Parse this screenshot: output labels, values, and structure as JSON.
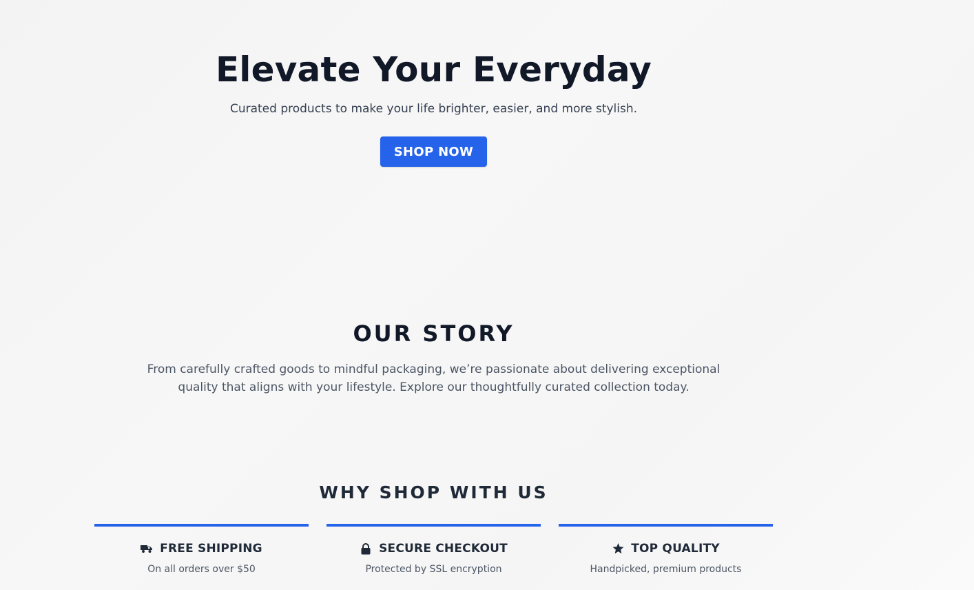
{
  "hero": {
    "title": "Elevate Your Everyday",
    "subtitle": "Curated products to make your life brighter, easier, and more stylish.",
    "button_label": "SHOP NOW"
  },
  "story": {
    "title": "OUR STORY",
    "text": "From carefully crafted goods to mindful packaging, we’re passionate about delivering exceptional quality that aligns with your lifestyle. Explore our thoughtfully curated collection today."
  },
  "why": {
    "title": "WHY SHOP WITH US",
    "features": [
      {
        "icon": "truck-icon",
        "title": "FREE SHIPPING",
        "desc": "On all orders over $50"
      },
      {
        "icon": "lock-icon",
        "title": "SECURE CHECKOUT",
        "desc": "Protected by SSL encryption"
      },
      {
        "icon": "star-icon",
        "title": "TOP QUALITY",
        "desc": "Handpicked, premium products"
      }
    ]
  },
  "colors": {
    "accent": "#2563eb",
    "heading": "#111827",
    "text": "#4b5563",
    "background": "#f5f5f5"
  }
}
